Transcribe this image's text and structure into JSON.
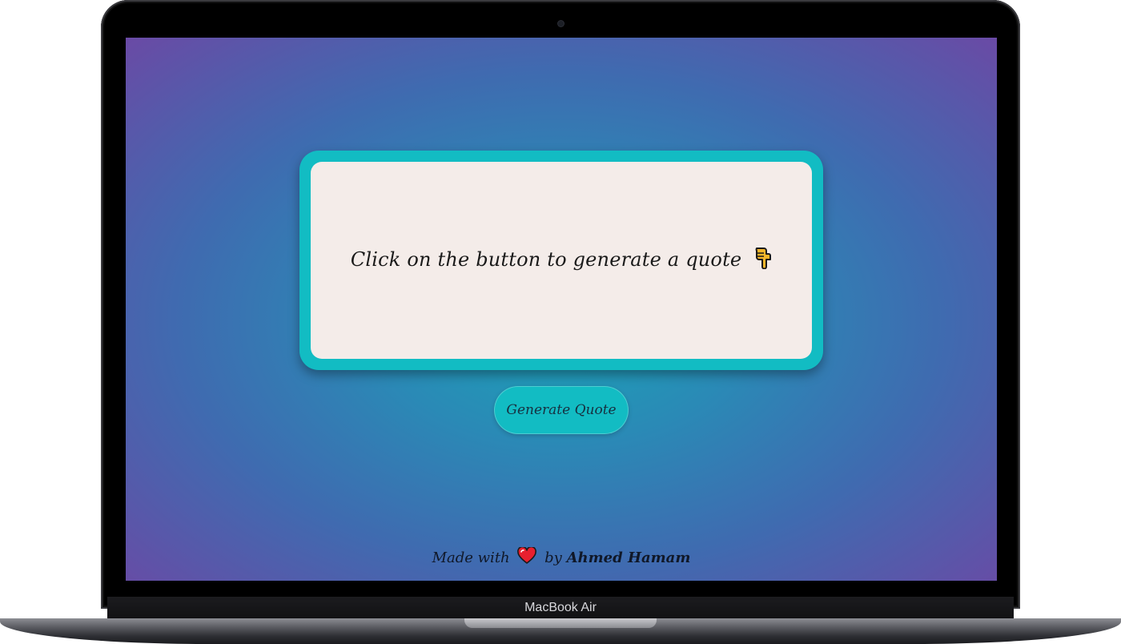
{
  "device": {
    "brand_label": "MacBook Air"
  },
  "quote": {
    "text": "Click on the button to generate a quote",
    "icon": "pointing-down-icon"
  },
  "button": {
    "label": "Generate Quote"
  },
  "footer": {
    "made_with": "Made with",
    "icon": "heart-icon",
    "by": "by",
    "author": "Ahmed Hamam"
  },
  "colors": {
    "accent": "#12bcc3",
    "card_background": "#f4ece9",
    "gradient_center": "#1aa3b8",
    "gradient_edge": "#6a4aa5",
    "heart": "#e8202f"
  }
}
